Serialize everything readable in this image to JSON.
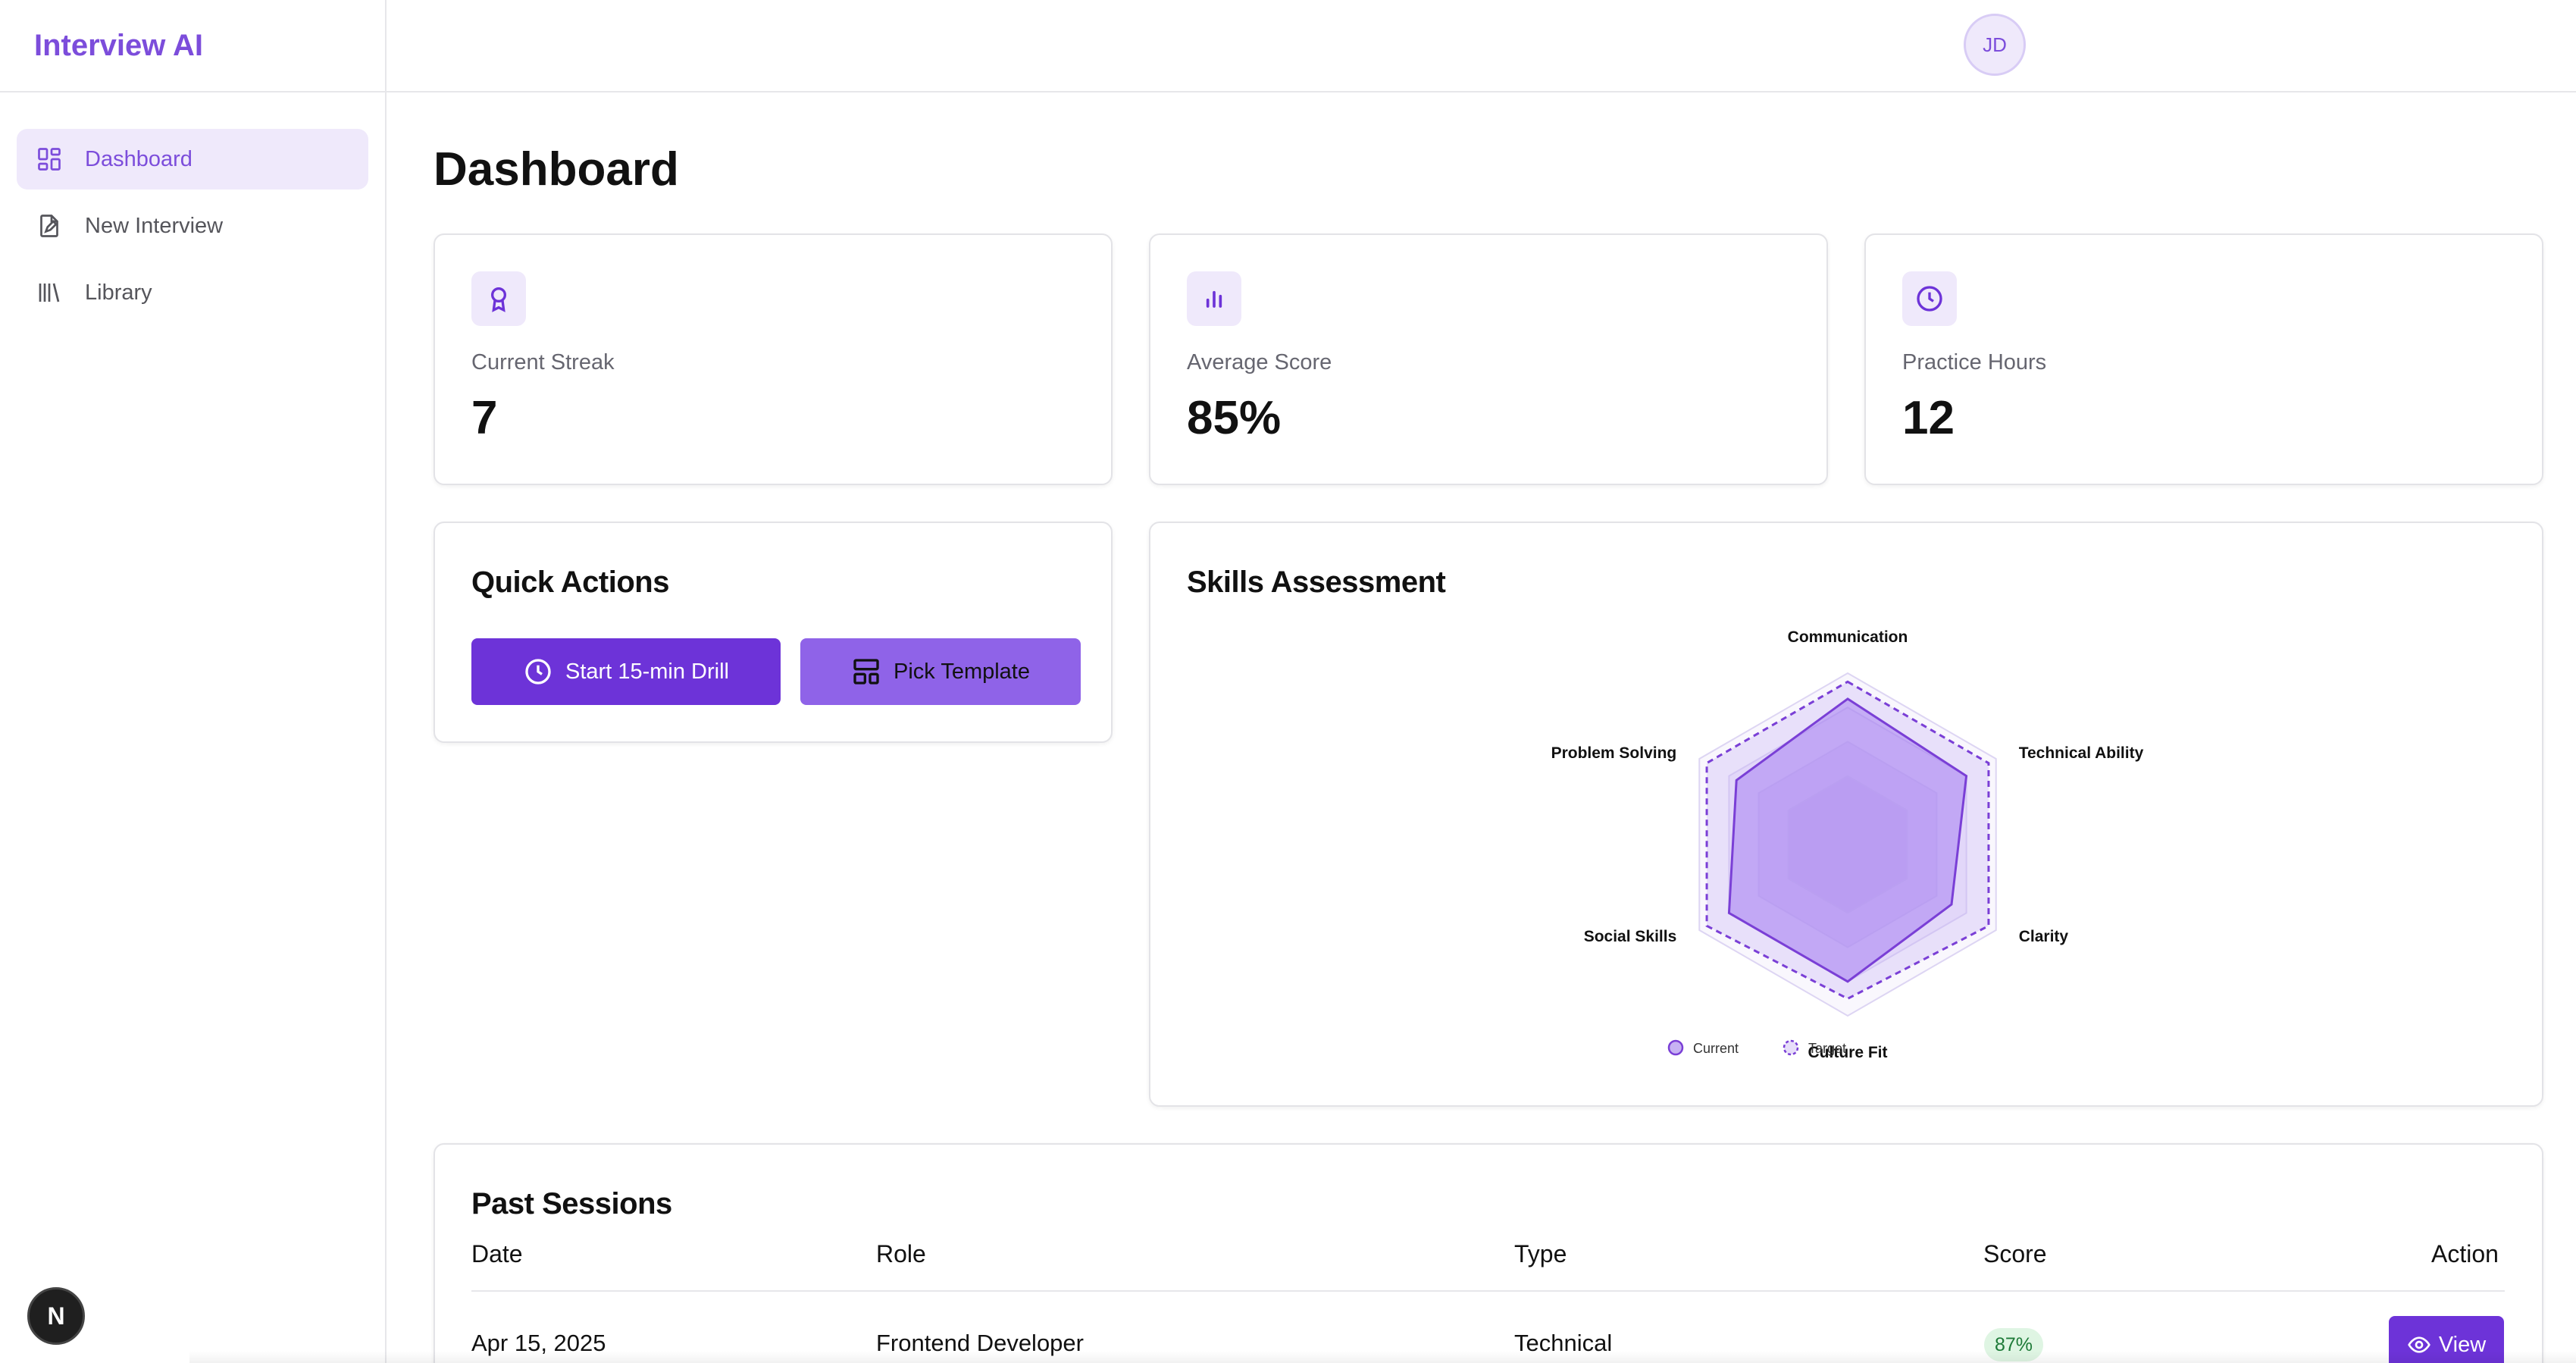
{
  "app": {
    "title": "Interview AI"
  },
  "sidebar": {
    "items": [
      {
        "label": "Dashboard",
        "icon": "dashboard-grid-icon",
        "active": true
      },
      {
        "label": "New Interview",
        "icon": "new-document-icon",
        "active": false
      },
      {
        "label": "Library",
        "icon": "library-books-icon",
        "active": false
      }
    ]
  },
  "header": {
    "avatar_initials": "JD"
  },
  "dev_badge": {
    "label": "N"
  },
  "page": {
    "title": "Dashboard"
  },
  "stats": [
    {
      "label": "Current Streak",
      "value": "7",
      "icon": "award-ribbon-icon"
    },
    {
      "label": "Average Score",
      "value": "85%",
      "icon": "bar-chart-icon"
    },
    {
      "label": "Practice Hours",
      "value": "12",
      "icon": "clock-icon"
    }
  ],
  "quick_actions": {
    "title": "Quick Actions",
    "start_drill_label": "Start 15-min Drill",
    "pick_template_label": "Pick Template"
  },
  "skills": {
    "title": "Skills Assessment"
  },
  "chart_data": {
    "type": "radar",
    "categories": [
      "Communication",
      "Technical Ability",
      "Clarity",
      "Culture Fit",
      "Social Skills",
      "Problem Solving"
    ],
    "series": [
      {
        "name": "Current",
        "values": [
          85,
          80,
          70,
          80,
          80,
          75
        ]
      },
      {
        "name": "Target",
        "values": [
          95,
          95,
          95,
          90,
          95,
          95
        ]
      }
    ],
    "rlim": [
      0,
      100
    ],
    "grid": true,
    "legend": "bottom"
  },
  "past_sessions": {
    "title": "Past Sessions",
    "columns": [
      "Date",
      "Role",
      "Type",
      "Score",
      "Action"
    ],
    "rows": [
      {
        "date": "Apr 15, 2025",
        "role": "Frontend Developer",
        "type": "Technical",
        "score": "87%",
        "action": "View"
      }
    ]
  },
  "colors": {
    "accent": "#7c4ddb",
    "primary_button": "#6d33d8",
    "secondary_button": "#8f63e8",
    "score_pill_bg": "#dff5e3"
  }
}
